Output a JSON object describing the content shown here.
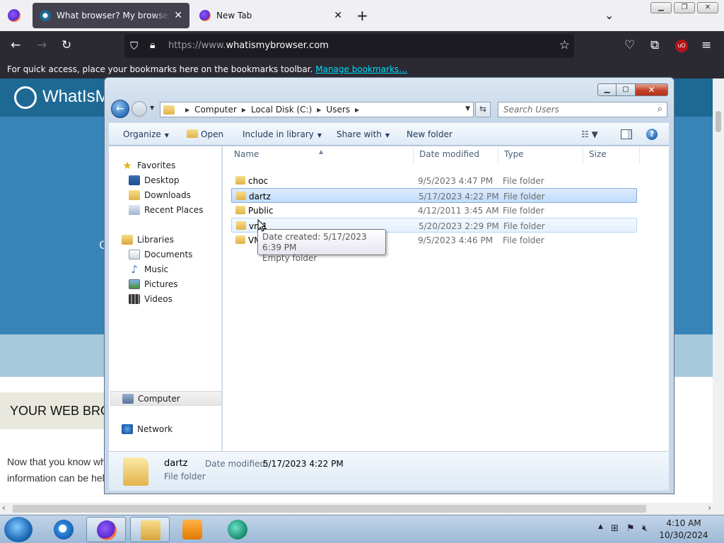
{
  "firefox": {
    "tabs": [
      {
        "title": "What browser? My browser? Is this a good browser?",
        "close": "✕"
      },
      {
        "title": "New Tab",
        "close": "✕"
      }
    ],
    "new_tab": "+",
    "tab_list": "⌄",
    "url": {
      "prefix": "https://www.",
      "domain": "whatismybrowser.com"
    },
    "bookmarks_text": "For quick access, place your bookmarks here on the bookmarks toolbar.",
    "manage_bookmarks": "Manage bookmarks…"
  },
  "webpage": {
    "site_name": "WhatIsMyBrowser",
    "section_heading": "YOUR WEB BROWSER",
    "para_line1": "Now that you know what",
    "para_line2": "information can be help"
  },
  "explorer": {
    "breadcrumb": [
      "Computer",
      "Local Disk (C:)",
      "Users"
    ],
    "search_placeholder": "Search Users",
    "toolbar": {
      "organize": "Organize",
      "open": "Open",
      "include": "Include in library",
      "share": "Share with",
      "new_folder": "New folder"
    },
    "nav": {
      "favorites": "Favorites",
      "desktop": "Desktop",
      "downloads": "Downloads",
      "recent": "Recent Places",
      "libraries": "Libraries",
      "documents": "Documents",
      "music": "Music",
      "pictures": "Pictures",
      "videos": "Videos",
      "computer": "Computer",
      "network": "Network"
    },
    "columns": {
      "name": "Name",
      "date": "Date modified",
      "type": "Type",
      "size": "Size"
    },
    "files": [
      {
        "name": "choc",
        "date": "9/5/2023 4:47 PM",
        "type": "File folder"
      },
      {
        "name": "dartz",
        "date": "5/17/2023 4:22 PM",
        "type": "File folder"
      },
      {
        "name": "Public",
        "date": "4/12/2011 3:45 AM",
        "type": "File folder"
      },
      {
        "name": "vm1",
        "date": "5/20/2023 2:29 PM",
        "type": "File folder"
      },
      {
        "name": "VM",
        "date": "9/5/2023 4:46 PM",
        "type": "File folder"
      }
    ],
    "tooltip": {
      "line1": "Date created: 5/17/2023 6:39 PM",
      "line2": "Empty folder"
    },
    "details": {
      "name": "dartz",
      "type": "File folder",
      "modified_label": "Date modified:",
      "modified_value": "5/17/2023 4:22 PM"
    }
  },
  "taskbar": {
    "time": "4:10 AM",
    "date": "10/30/2024"
  }
}
